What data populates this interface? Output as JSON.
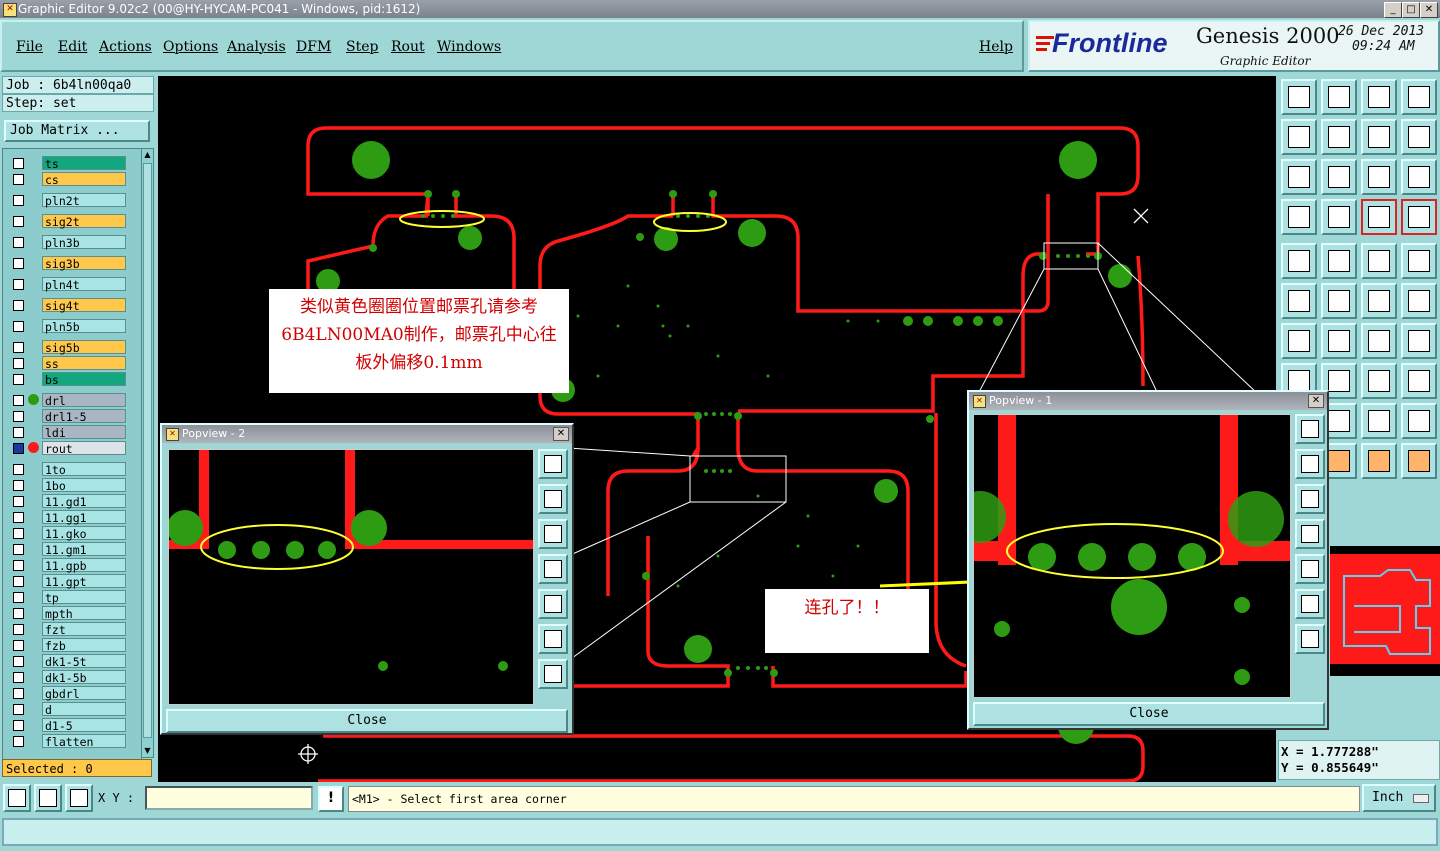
{
  "window": {
    "title": "Graphic Editor 9.02c2 (00@HY-HYCAM-PC041 - Windows, pid:1612)",
    "min": "_",
    "max": "□",
    "close": "✕"
  },
  "menu": {
    "items": [
      "File",
      "Edit",
      "Actions",
      "Options",
      "Analysis",
      "DFM",
      "Step",
      "Rout",
      "Windows"
    ],
    "help": "Help"
  },
  "brand": {
    "logo": "Frontline",
    "product": "Genesis 2000",
    "subtitle": "Graphic Editor",
    "date": "26 Dec 2013",
    "time": "09:24 AM"
  },
  "job": {
    "job_line": "Job : 6b4ln00qa0",
    "step_line": "Step: set",
    "matrix_button": "Job Matrix ..."
  },
  "layers": [
    {
      "name": "ts",
      "color": "#13a77d"
    },
    {
      "name": "cs",
      "color": "#ffc84a"
    },
    {
      "name": "pln2t",
      "color": "#a8e4e4"
    },
    {
      "name": "sig2t",
      "color": "#ffc84a"
    },
    {
      "name": "pln3b",
      "color": "#a8e4e4"
    },
    {
      "name": "sig3b",
      "color": "#ffc84a"
    },
    {
      "name": "pln4t",
      "color": "#a8e4e4"
    },
    {
      "name": "sig4t",
      "color": "#ffc84a"
    },
    {
      "name": "pln5b",
      "color": "#a8e4e4"
    },
    {
      "name": "sig5b",
      "color": "#ffc84a"
    },
    {
      "name": "ss",
      "color": "#ffc84a"
    },
    {
      "name": "bs",
      "color": "#13a77d"
    },
    {
      "name": "drl",
      "color": "#a9b7c4"
    },
    {
      "name": "drl1-5",
      "color": "#a9b7c4"
    },
    {
      "name": "ldi",
      "color": "#a9b7c4"
    },
    {
      "name": "rout",
      "color": "#dde3e8"
    },
    {
      "name": "1to",
      "color": "#a8e4e4"
    },
    {
      "name": "1bo",
      "color": "#a8e4e4"
    },
    {
      "name": "11.gd1",
      "color": "#a8e4e4"
    },
    {
      "name": "11.gg1",
      "color": "#a8e4e4"
    },
    {
      "name": "11.gko",
      "color": "#a8e4e4"
    },
    {
      "name": "11.gm1",
      "color": "#a8e4e4"
    },
    {
      "name": "11.gpb",
      "color": "#a8e4e4"
    },
    {
      "name": "11.gpt",
      "color": "#a8e4e4"
    },
    {
      "name": "tp",
      "color": "#a8e4e4"
    },
    {
      "name": "mpth",
      "color": "#a8e4e4"
    },
    {
      "name": "fzt",
      "color": "#a8e4e4"
    },
    {
      "name": "fzb",
      "color": "#a8e4e4"
    },
    {
      "name": "dk1-5t",
      "color": "#a8e4e4"
    },
    {
      "name": "dk1-5b",
      "color": "#a8e4e4"
    },
    {
      "name": "gbdrl",
      "color": "#a8e4e4"
    },
    {
      "name": "d",
      "color": "#a8e4e4"
    },
    {
      "name": "d1-5",
      "color": "#a8e4e4"
    },
    {
      "name": "flatten",
      "color": "#a8e4e4"
    }
  ],
  "selected": "Selected : 0",
  "annotations": {
    "note_main": "类似黄色圈圈位置邮票孔请参考6B4LN00MA0制作，邮票孔中心往板外偏移0.1mm",
    "note_linked": "连孔了！！"
  },
  "popview2": {
    "title": "Popview - 2",
    "close": "Close"
  },
  "popview1": {
    "title": "Popview - 1",
    "close": "Close"
  },
  "coords": {
    "x": "X = 1.777288\"",
    "y": "Y = 0.855649\""
  },
  "status": {
    "xy_label": "X Y :",
    "xy_value": "",
    "prompt": "<M1> - Select first area corner",
    "units": "Inch",
    "bang": "!"
  },
  "colors": {
    "board": "#000000",
    "rout": "#ff0000",
    "pad": "#2e9c12",
    "highlight": "#ffff33",
    "panel": "#9fd6d6"
  }
}
